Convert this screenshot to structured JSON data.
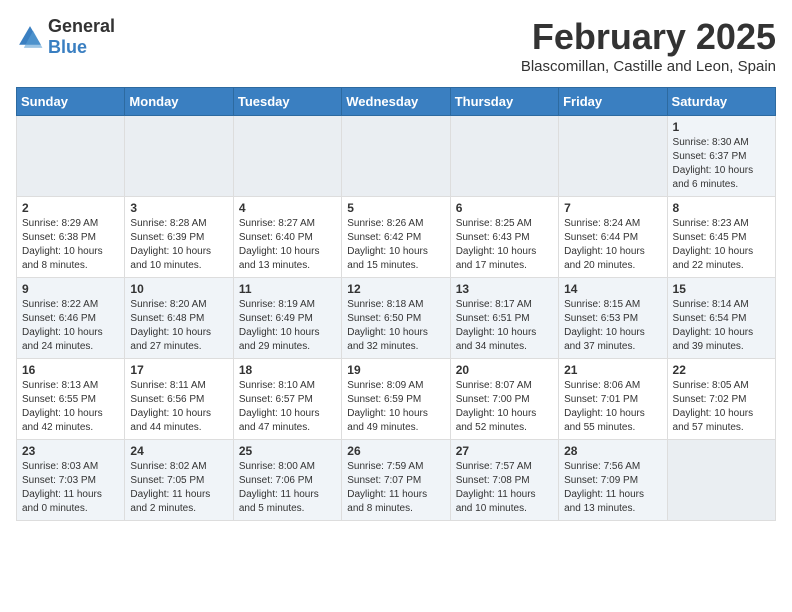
{
  "logo": {
    "text_general": "General",
    "text_blue": "Blue"
  },
  "title": "February 2025",
  "subtitle": "Blascomillan, Castille and Leon, Spain",
  "days_of_week": [
    "Sunday",
    "Monday",
    "Tuesday",
    "Wednesday",
    "Thursday",
    "Friday",
    "Saturday"
  ],
  "weeks": [
    {
      "days": [
        {
          "num": "",
          "empty": true
        },
        {
          "num": "",
          "empty": true
        },
        {
          "num": "",
          "empty": true
        },
        {
          "num": "",
          "empty": true
        },
        {
          "num": "",
          "empty": true
        },
        {
          "num": "",
          "empty": true
        },
        {
          "num": "1",
          "sunrise": "Sunrise: 8:30 AM",
          "sunset": "Sunset: 6:37 PM",
          "daylight": "Daylight: 10 hours and 6 minutes."
        }
      ]
    },
    {
      "days": [
        {
          "num": "2",
          "sunrise": "Sunrise: 8:29 AM",
          "sunset": "Sunset: 6:38 PM",
          "daylight": "Daylight: 10 hours and 8 minutes."
        },
        {
          "num": "3",
          "sunrise": "Sunrise: 8:28 AM",
          "sunset": "Sunset: 6:39 PM",
          "daylight": "Daylight: 10 hours and 10 minutes."
        },
        {
          "num": "4",
          "sunrise": "Sunrise: 8:27 AM",
          "sunset": "Sunset: 6:40 PM",
          "daylight": "Daylight: 10 hours and 13 minutes."
        },
        {
          "num": "5",
          "sunrise": "Sunrise: 8:26 AM",
          "sunset": "Sunset: 6:42 PM",
          "daylight": "Daylight: 10 hours and 15 minutes."
        },
        {
          "num": "6",
          "sunrise": "Sunrise: 8:25 AM",
          "sunset": "Sunset: 6:43 PM",
          "daylight": "Daylight: 10 hours and 17 minutes."
        },
        {
          "num": "7",
          "sunrise": "Sunrise: 8:24 AM",
          "sunset": "Sunset: 6:44 PM",
          "daylight": "Daylight: 10 hours and 20 minutes."
        },
        {
          "num": "8",
          "sunrise": "Sunrise: 8:23 AM",
          "sunset": "Sunset: 6:45 PM",
          "daylight": "Daylight: 10 hours and 22 minutes."
        }
      ]
    },
    {
      "days": [
        {
          "num": "9",
          "sunrise": "Sunrise: 8:22 AM",
          "sunset": "Sunset: 6:46 PM",
          "daylight": "Daylight: 10 hours and 24 minutes."
        },
        {
          "num": "10",
          "sunrise": "Sunrise: 8:20 AM",
          "sunset": "Sunset: 6:48 PM",
          "daylight": "Daylight: 10 hours and 27 minutes."
        },
        {
          "num": "11",
          "sunrise": "Sunrise: 8:19 AM",
          "sunset": "Sunset: 6:49 PM",
          "daylight": "Daylight: 10 hours and 29 minutes."
        },
        {
          "num": "12",
          "sunrise": "Sunrise: 8:18 AM",
          "sunset": "Sunset: 6:50 PM",
          "daylight": "Daylight: 10 hours and 32 minutes."
        },
        {
          "num": "13",
          "sunrise": "Sunrise: 8:17 AM",
          "sunset": "Sunset: 6:51 PM",
          "daylight": "Daylight: 10 hours and 34 minutes."
        },
        {
          "num": "14",
          "sunrise": "Sunrise: 8:15 AM",
          "sunset": "Sunset: 6:53 PM",
          "daylight": "Daylight: 10 hours and 37 minutes."
        },
        {
          "num": "15",
          "sunrise": "Sunrise: 8:14 AM",
          "sunset": "Sunset: 6:54 PM",
          "daylight": "Daylight: 10 hours and 39 minutes."
        }
      ]
    },
    {
      "days": [
        {
          "num": "16",
          "sunrise": "Sunrise: 8:13 AM",
          "sunset": "Sunset: 6:55 PM",
          "daylight": "Daylight: 10 hours and 42 minutes."
        },
        {
          "num": "17",
          "sunrise": "Sunrise: 8:11 AM",
          "sunset": "Sunset: 6:56 PM",
          "daylight": "Daylight: 10 hours and 44 minutes."
        },
        {
          "num": "18",
          "sunrise": "Sunrise: 8:10 AM",
          "sunset": "Sunset: 6:57 PM",
          "daylight": "Daylight: 10 hours and 47 minutes."
        },
        {
          "num": "19",
          "sunrise": "Sunrise: 8:09 AM",
          "sunset": "Sunset: 6:59 PM",
          "daylight": "Daylight: 10 hours and 49 minutes."
        },
        {
          "num": "20",
          "sunrise": "Sunrise: 8:07 AM",
          "sunset": "Sunset: 7:00 PM",
          "daylight": "Daylight: 10 hours and 52 minutes."
        },
        {
          "num": "21",
          "sunrise": "Sunrise: 8:06 AM",
          "sunset": "Sunset: 7:01 PM",
          "daylight": "Daylight: 10 hours and 55 minutes."
        },
        {
          "num": "22",
          "sunrise": "Sunrise: 8:05 AM",
          "sunset": "Sunset: 7:02 PM",
          "daylight": "Daylight: 10 hours and 57 minutes."
        }
      ]
    },
    {
      "days": [
        {
          "num": "23",
          "sunrise": "Sunrise: 8:03 AM",
          "sunset": "Sunset: 7:03 PM",
          "daylight": "Daylight: 11 hours and 0 minutes."
        },
        {
          "num": "24",
          "sunrise": "Sunrise: 8:02 AM",
          "sunset": "Sunset: 7:05 PM",
          "daylight": "Daylight: 11 hours and 2 minutes."
        },
        {
          "num": "25",
          "sunrise": "Sunrise: 8:00 AM",
          "sunset": "Sunset: 7:06 PM",
          "daylight": "Daylight: 11 hours and 5 minutes."
        },
        {
          "num": "26",
          "sunrise": "Sunrise: 7:59 AM",
          "sunset": "Sunset: 7:07 PM",
          "daylight": "Daylight: 11 hours and 8 minutes."
        },
        {
          "num": "27",
          "sunrise": "Sunrise: 7:57 AM",
          "sunset": "Sunset: 7:08 PM",
          "daylight": "Daylight: 11 hours and 10 minutes."
        },
        {
          "num": "28",
          "sunrise": "Sunrise: 7:56 AM",
          "sunset": "Sunset: 7:09 PM",
          "daylight": "Daylight: 11 hours and 13 minutes."
        },
        {
          "num": "",
          "empty": true
        }
      ]
    }
  ]
}
